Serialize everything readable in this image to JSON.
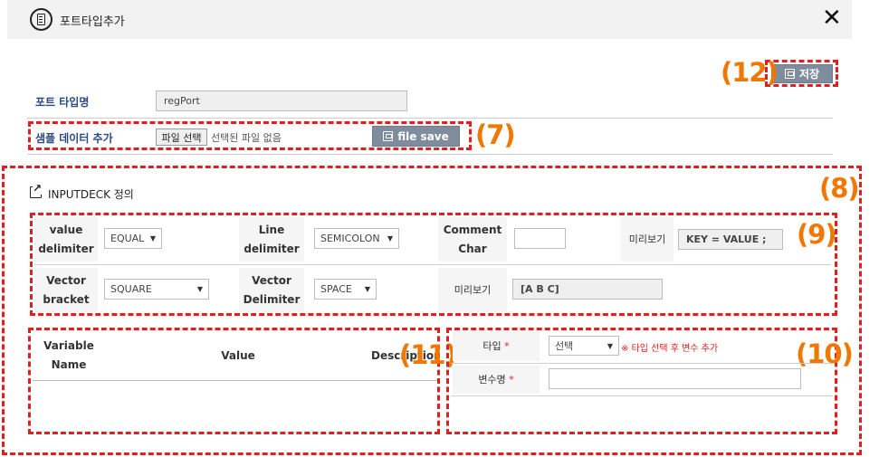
{
  "window": {
    "title": "포트타입추가",
    "close_glyph": "✕"
  },
  "callouts": {
    "c7": "(7)",
    "c8": "(8)",
    "c9": "(9)",
    "c10": "(10)",
    "c11": "(11)",
    "c12": "(12)"
  },
  "toolbar": {
    "save_label": "저장"
  },
  "form": {
    "port_type_label": "포트 타입명",
    "port_type_value": "regPort",
    "sample_label": "샘플 데이터 추가",
    "file_choose_label": "파일 선택",
    "file_status": "선택된 파일 없음",
    "file_save_label": "file save"
  },
  "inputdeck": {
    "title": "INPUTDECK 정의",
    "value_delimiter_label_1": "value",
    "value_delimiter_label_2": "delimiter",
    "value_delimiter_selected": "EQUAL",
    "line_delimiter_label_1": "Line",
    "line_delimiter_label_2": "delimiter",
    "line_delimiter_selected": "SEMICOLON",
    "comment_char_label_1": "Comment",
    "comment_char_label_2": "Char",
    "comment_char_value": "",
    "preview_label": "미리보기",
    "preview_value_1": "KEY = VALUE ;",
    "vector_bracket_label_1": "Vector",
    "vector_bracket_label_2": "bracket",
    "vector_bracket_selected": "SQUARE",
    "vector_delimiter_label_1": "Vector",
    "vector_delimiter_label_2": "Delimiter",
    "vector_delimiter_selected": "SPACE",
    "preview_value_2": "[A B C]"
  },
  "variable_table": {
    "col_variable_1": "Variable",
    "col_variable_2": "Name",
    "col_value": "Value",
    "col_description": "Description"
  },
  "variable_form": {
    "type_label": "타입",
    "type_selected": "선택",
    "required_mark": "*",
    "type_hint": "※ 타입 선택 후 변수 추가",
    "var_name_label": "변수명",
    "var_name_value": ""
  },
  "colors": {
    "accent_red": "#e02020",
    "callout_orange": "#f07800",
    "button_gray": "#7f8c9d",
    "label_blue": "#2a4a86"
  }
}
